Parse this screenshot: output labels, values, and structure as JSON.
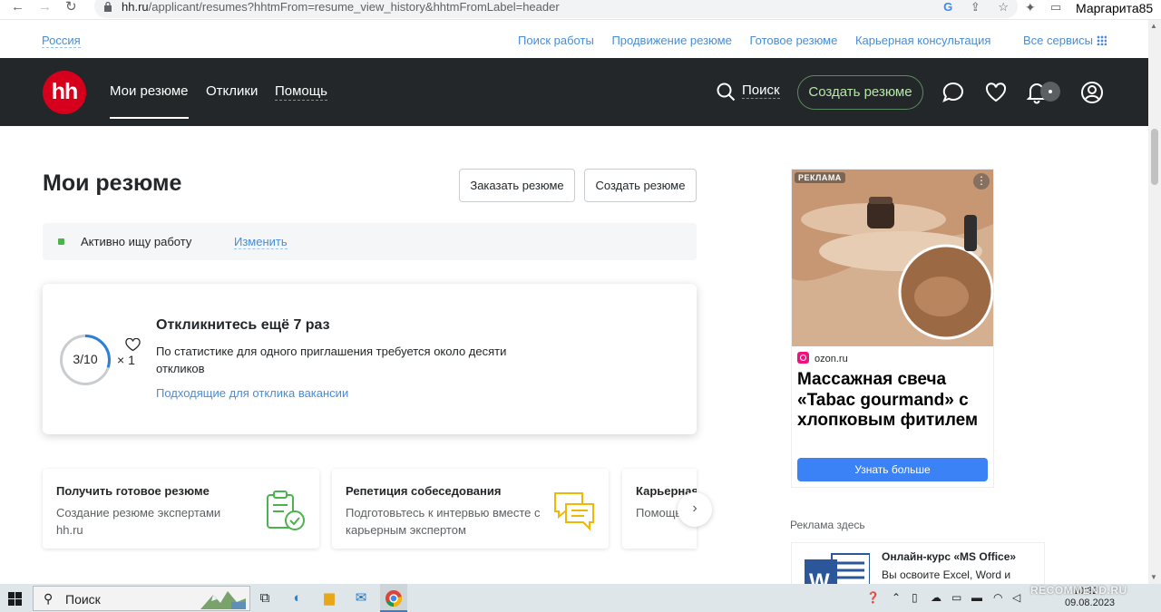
{
  "browser": {
    "url_host": "hh.ru",
    "url_path": "/applicant/resumes?hhtmFrom=resume_view_history&hhtmFromLabel=header",
    "profile_name": "Маргарита85"
  },
  "toplinks": {
    "region": "Россия",
    "items": [
      "Поиск работы",
      "Продвижение резюме",
      "Готовое резюме",
      "Карьерная консультация",
      "Все сервисы"
    ]
  },
  "header": {
    "logo": "hh",
    "nav": [
      "Мои резюме",
      "Отклики",
      "Помощь"
    ],
    "search_label": "Поиск",
    "create_button": "Создать резюме",
    "brand_color": "#d6001c"
  },
  "main": {
    "title": "Мои резюме",
    "order_button": "Заказать резюме",
    "create_button": "Создать резюме",
    "status": {
      "text": "Активно ищу работу",
      "change_link": "Изменить",
      "color": "#4bb24e"
    },
    "progress_card": {
      "counter": "3/10",
      "progress": 0.3,
      "multiplier": "× 1",
      "title": "Откликнитесь ещё 7 раз",
      "description": "По статистике для одного приглашения требуется около десяти откликов",
      "link": "Подходящие для отклика вакансии"
    },
    "services": [
      {
        "title": "Получить готовое резюме",
        "description": "Создание резюме экспертами hh.ru",
        "icon": "clipboard-check-icon"
      },
      {
        "title": "Репетиция собеседования",
        "description": "Подготовьтесь к интервью вместе с карьерным экспертом",
        "icon": "chat-bubbles-icon"
      },
      {
        "title": "Карьерная консультация",
        "description": "Помощь карьерного эксперта на вопросы",
        "icon": "career-icon"
      }
    ]
  },
  "ad": {
    "badge": "РЕКЛАМА",
    "source": "ozon.ru",
    "headline": "Массажная свеча «Tabac gourmand» с хлопковым фитилем",
    "button": "Узнать больше",
    "ads_here": "Реклама здесь",
    "ad2_title": "Онлайн-курс «MS Office»",
    "ad2_desc": "Вы освоите Excel, Word и"
  },
  "taskbar": {
    "search": "Поиск",
    "time": "10:32",
    "date": "09.08.2023",
    "watermark": "RECOMMEND.RU"
  }
}
